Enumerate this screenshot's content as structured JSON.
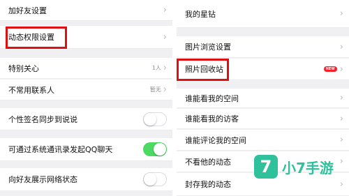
{
  "left_panel": {
    "items": [
      {
        "label": "加好友设置",
        "control": "chevron"
      },
      {
        "label": "动态权限设置",
        "control": "chevron"
      },
      {
        "label": "特别关心",
        "control": "chevron",
        "value": "1人"
      },
      {
        "label": "不常用联系人",
        "control": "chevron",
        "value": "暂无"
      },
      {
        "label": "个性签名同步到说说",
        "control": "toggle",
        "toggle_on": false
      },
      {
        "label": "可通过系统通讯录发起QQ聊天",
        "control": "toggle",
        "toggle_on": true
      },
      {
        "label": "向好友展示网络状态",
        "control": "toggle",
        "toggle_on": false
      }
    ]
  },
  "right_panel": {
    "items": [
      {
        "label": "我的星钻",
        "control": "chevron"
      },
      {
        "label": "图片浏览设置",
        "control": "chevron"
      },
      {
        "label": "照片回收站",
        "control": "chevron",
        "badge": "NEW"
      },
      {
        "label": "谁能看我的空间",
        "control": "chevron"
      },
      {
        "label": "谁能看我的访客",
        "control": "chevron"
      },
      {
        "label": "谁能评论我的空间",
        "control": "chevron"
      },
      {
        "label": "不看他的动态",
        "control": "chevron"
      },
      {
        "label": "封存我的动态",
        "control": "chevron"
      }
    ]
  },
  "chevron_glyph": "›",
  "watermark": {
    "logo": "7",
    "text": "小7手游",
    "color": "#2fc19c"
  },
  "colors": {
    "highlight": "#e01010",
    "toggle_on": "#4cd964",
    "badge": "#f5222d"
  }
}
